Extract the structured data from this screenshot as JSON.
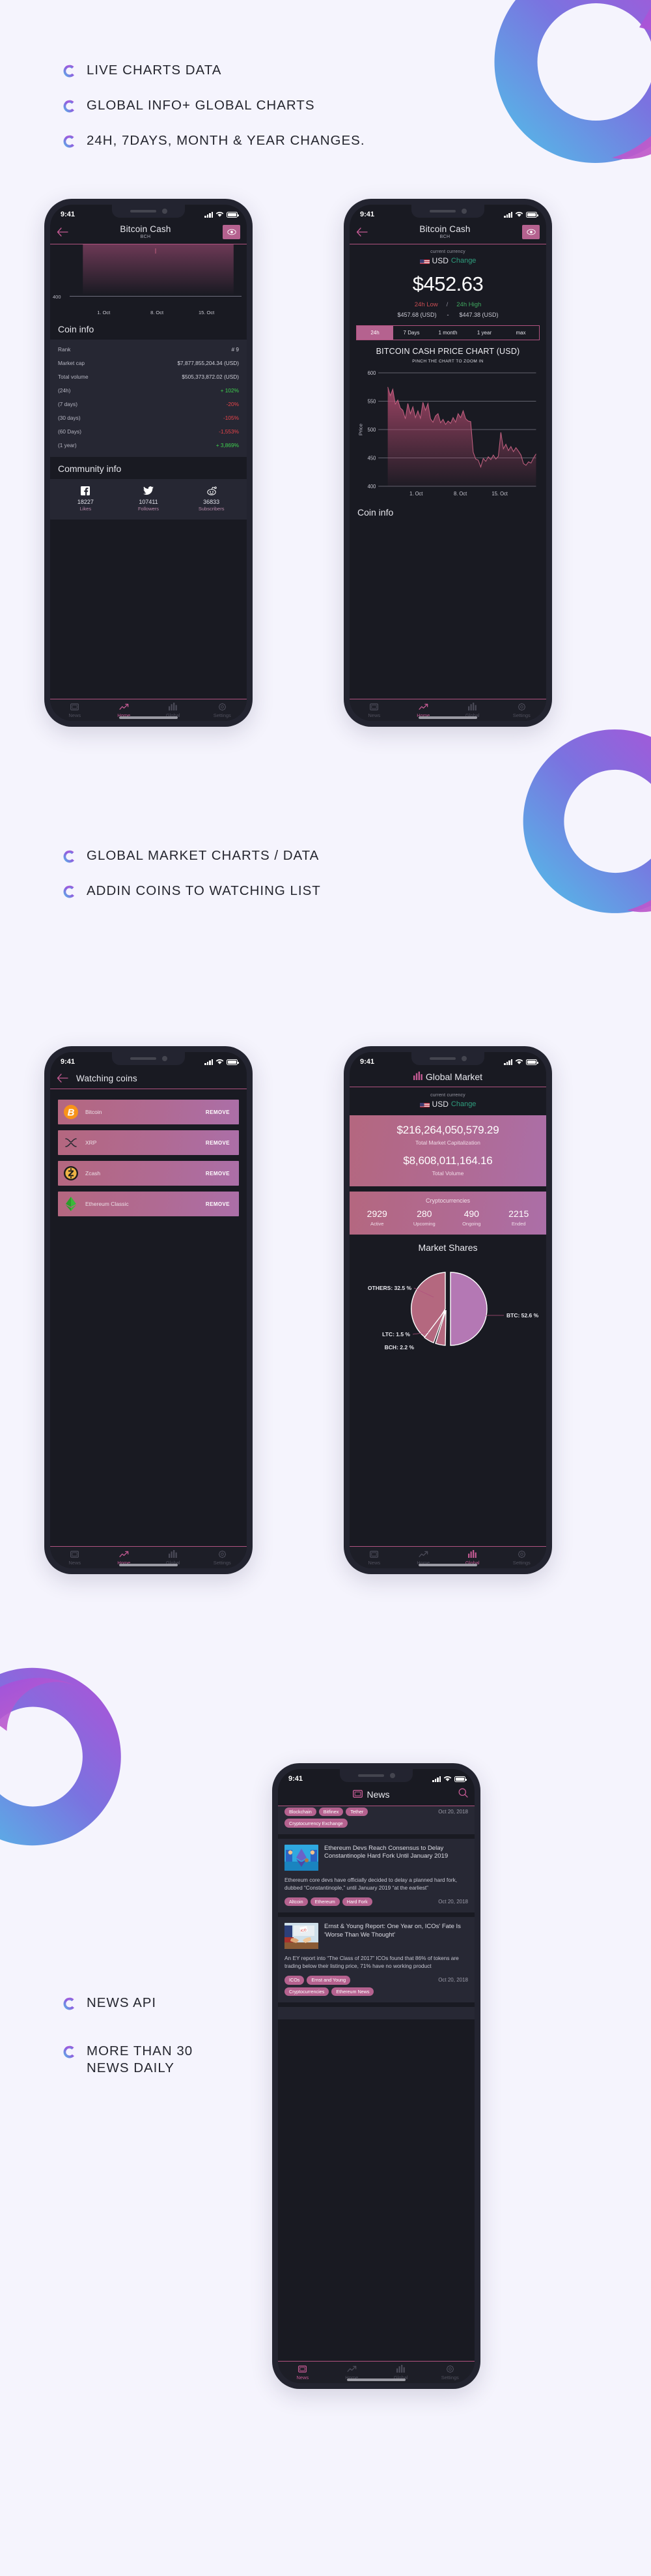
{
  "page": {
    "background": "#f5f4fd",
    "accent_pink": "#b5628f",
    "accent_line": "#b0527f",
    "brand_gradient_from": "#4fb9e8",
    "brand_gradient_to": "#9a4fe0"
  },
  "feature_groups": [
    {
      "name": "charts-features",
      "items": [
        "LIVE CHARTS DATA",
        "GLOBAL INFO+ GLOBAL CHARTS",
        "24H, 7DAYS, MONTH & YEAR CHANGES."
      ]
    },
    {
      "name": "market-features",
      "items": [
        "GLOBAL MARKET CHARTS / DATA",
        "ADDIN COINS TO WATCHING LIST"
      ]
    },
    {
      "name": "news-features",
      "items": [
        "NEWS API",
        "MORE THAN 30\nNEWS DAILY"
      ]
    }
  ],
  "status_bar": {
    "time": "9:41",
    "signal_icon": "signal-bars-icon",
    "wifi_icon": "wifi-icon",
    "battery_icon": "battery-icon"
  },
  "tabbar": {
    "items": [
      {
        "label": "News",
        "icon": "news-icon"
      },
      {
        "label": "Home",
        "icon": "trending-up-icon"
      },
      {
        "label": "Global",
        "icon": "bar-chart-icon"
      },
      {
        "label": "Settings",
        "icon": "gear-icon"
      }
    ]
  },
  "screen_coin_info": {
    "appbar": {
      "back_icon": "back-arrow-icon",
      "title": "Bitcoin Cash",
      "subtitle": "BCH",
      "watch_icon": "eye-icon"
    },
    "mini_chart": {
      "y_label": "400",
      "x_ticks": [
        "1. Oct",
        "8. Oct",
        "15. Oct"
      ]
    },
    "section_title": "Coin info",
    "rows": [
      {
        "label": "Rank",
        "value": "# 9",
        "tone": "neutral"
      },
      {
        "label": "Market cap",
        "value": "$7,877,855,204.34 (USD)",
        "tone": "neutral"
      },
      {
        "label": "Total volume",
        "value": "$505,373,872.02 (USD)",
        "tone": "neutral"
      },
      {
        "label": "(24h)",
        "value": "+ 102%",
        "tone": "up"
      },
      {
        "label": "(7 days)",
        "value": "-20%",
        "tone": "down"
      },
      {
        "label": "(30 days)",
        "value": "-105%",
        "tone": "down"
      },
      {
        "label": "(60 Days)",
        "value": "-1,553%",
        "tone": "down"
      },
      {
        "label": "(1 year)",
        "value": "+ 3,869%",
        "tone": "up"
      }
    ],
    "community_title": "Community info",
    "community": [
      {
        "icon": "facebook-icon",
        "count": "18227",
        "label": "Likes"
      },
      {
        "icon": "twitter-icon",
        "count": "107411",
        "label": "Followers"
      },
      {
        "icon": "reddit-icon",
        "count": "36833",
        "label": "Subscribers"
      }
    ],
    "active_tab": "Home"
  },
  "screen_price": {
    "appbar": {
      "back_icon": "back-arrow-icon",
      "title": "Bitcoin Cash",
      "subtitle": "BCH",
      "watch_icon": "eye-icon"
    },
    "currency_label": "current currency",
    "currency_code": "USD",
    "currency_change": "Change",
    "currency_flag": "us-flag-icon",
    "price": "$452.63",
    "low_label": "24h Low",
    "high_label": "24h High",
    "separator": "/",
    "low_value": "$457.68 (USD)",
    "value_dash": "-",
    "high_value": "$447.38 (USD)",
    "ranges": [
      "24h",
      "7 Days",
      "1 month",
      "1 year",
      "max"
    ],
    "range_selected": "24h",
    "chart_title": "BITCOIN CASH PRICE CHART (USD)",
    "chart_hint": "PINCH THE CHART TO ZOOM IN",
    "section_title": "Coin info",
    "active_tab": "Home"
  },
  "screen_watching": {
    "appbar": {
      "back_icon": "back-arrow-icon",
      "title": "Watching coins"
    },
    "remove_label": "REMOVE",
    "coins": [
      {
        "name": "Bitcoin",
        "icon": "bitcoin-icon"
      },
      {
        "name": "XRP",
        "icon": "xrp-icon"
      },
      {
        "name": "Zcash",
        "icon": "zcash-icon"
      },
      {
        "name": "Ethereum Classic",
        "icon": "ethereum-classic-icon"
      }
    ],
    "active_tab": "Home"
  },
  "screen_global": {
    "title": "Global Market",
    "title_icon": "bar-chart-icon",
    "currency_label": "current currency",
    "currency_code": "USD",
    "currency_change": "Change",
    "currency_flag": "us-flag-icon",
    "market_cap": "$216,264,050,579.29",
    "market_cap_label": "Total Market Capitalization",
    "total_volume": "$8,608,011,164.16",
    "total_volume_label": "Total Volume",
    "crypto_head": "Cryptocurrencies",
    "crypto_stats": [
      {
        "value": "2929",
        "label": "Active"
      },
      {
        "value": "280",
        "label": "Upcoming"
      },
      {
        "value": "490",
        "label": "Ongoing"
      },
      {
        "value": "2215",
        "label": "Ended"
      }
    ],
    "market_shares_title": "Market Shares",
    "active_tab": "Global"
  },
  "screen_news": {
    "title": "News",
    "title_icon": "news-icon",
    "search_icon": "search-icon",
    "partial_article": {
      "tags": [
        "Blockchain",
        "Bitfinex",
        "Tether",
        "Cryptocurrency Exchange"
      ],
      "date": "Oct 20, 2018"
    },
    "articles": [
      {
        "thumb": "ethereum-devs-illustration",
        "title": "Ethereum Devs Reach Consensus to Delay Constantinople Hard Fork Until January 2019",
        "body": "Ethereum core devs have officially decided to delay a planned hard fork, dubbed “Constantinople,” until January 2019 “at the earliest”",
        "tags": [
          "Altcoin",
          "Ethereum",
          "Hard Fork"
        ],
        "date": "Oct 20, 2018"
      },
      {
        "thumb": "ico-handover-illustration",
        "title": "Ernst & Young Report: One Year on, ICOs' Fate Is 'Worse Than We Thought'",
        "body": "An EY report into “The Class of 2017” ICOs found that 86% of tokens are trading below their listing price, 71% have no working product",
        "tags": [
          "ICOs",
          "Ernst and Young",
          "Cryptocurrencies",
          "Ethereum News"
        ],
        "date": "Oct 20, 2018"
      }
    ],
    "active_tab": "News"
  },
  "chart_data": [
    {
      "name": "bch-price-chart",
      "type": "area",
      "title": "BITCOIN CASH PRICE CHART (USD)",
      "xlabel": "",
      "ylabel": "Price",
      "ylim": [
        400,
        600
      ],
      "yticks": [
        400,
        450,
        500,
        550,
        600
      ],
      "xticks": [
        "1. Oct",
        "8. Oct",
        "15. Oct"
      ],
      "grid": true,
      "series_color": "#c0607f",
      "values": [
        575,
        560,
        571,
        545,
        552,
        538,
        534,
        519,
        546,
        528,
        540,
        521,
        533,
        520,
        548,
        534,
        546,
        519,
        513,
        524,
        528,
        512,
        518,
        509,
        515,
        511,
        521,
        513,
        528,
        521,
        533,
        519,
        515,
        514,
        460,
        448,
        446,
        434,
        449,
        444,
        452,
        447,
        455,
        448,
        453,
        495,
        466,
        474,
        463,
        470,
        461,
        468,
        462,
        455,
        440,
        437,
        443,
        441,
        450,
        457
      ]
    },
    {
      "name": "market-shares-pie",
      "type": "pie",
      "title": "Market Shares",
      "labels": [
        "BTC",
        "OTHERS",
        "LTC",
        "BCH"
      ],
      "label_texts": [
        "BTC: 52.6 %",
        "OTHERS: 32.5 %",
        "LTC: 1.5 %",
        "BCH: 2.2 %"
      ],
      "values": [
        52.6,
        32.5,
        1.5,
        2.2
      ],
      "colors": [
        "#b478b4",
        "#b4687f",
        "#b4687f",
        "#b4687f"
      ],
      "legend": "callout-labels"
    }
  ]
}
